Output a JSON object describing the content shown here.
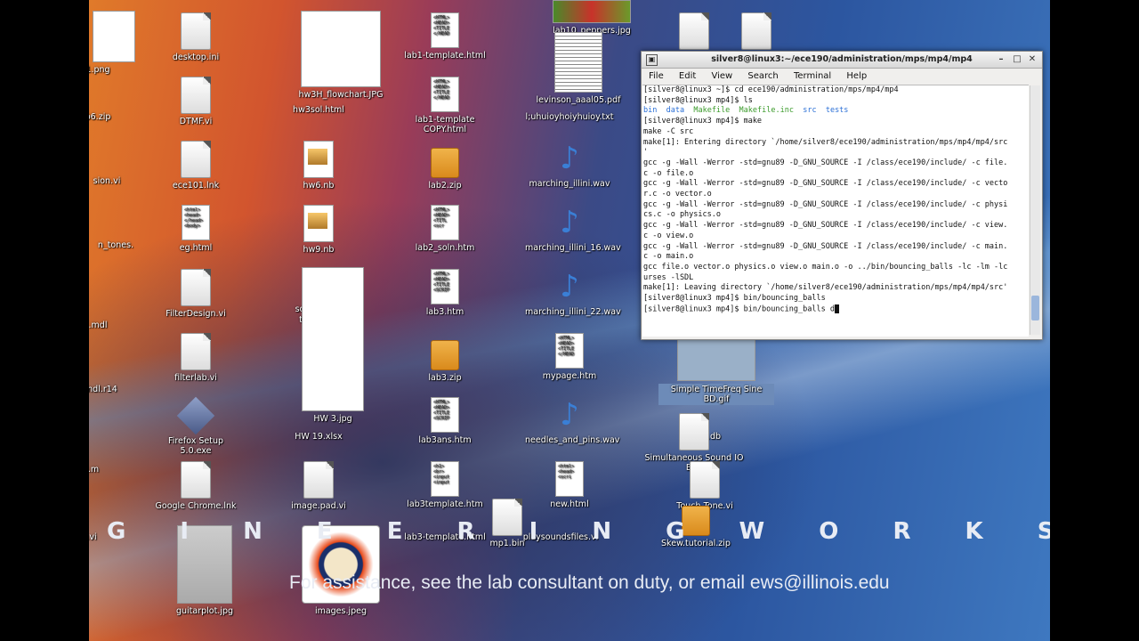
{
  "desktop": {
    "icons": [
      {
        "label": "1.png"
      },
      {
        "label": "desktop.ini"
      },
      {
        "label": "hw3H_flowchart.JPG"
      },
      {
        "label": "lab1-template.html"
      },
      {
        "label": "lab10_peppers.jpg"
      },
      {
        "label": "b6.zip"
      },
      {
        "label": "DTMF.vi"
      },
      {
        "label": "hw3sol.html"
      },
      {
        "label": "lab1-template COPY.html"
      },
      {
        "label": "levinson_aaal05.pdf"
      },
      {
        "label": "l;uhuioyhoiyhuioy.txt"
      },
      {
        "label": "sion.vi"
      },
      {
        "label": "ece101.lnk"
      },
      {
        "label": "hw6.nb"
      },
      {
        "label": "lab2.zip"
      },
      {
        "label": "marching_illini.wav"
      },
      {
        "label": "n_tones."
      },
      {
        "label": "eg.html"
      },
      {
        "label": "hw9.nb"
      },
      {
        "label": "lab2_soln.htm"
      },
      {
        "label": "marching_illini_16.wav"
      },
      {
        "label": ".mdl"
      },
      {
        "label": "FilterDesign.vi"
      },
      {
        "label": "sou"
      },
      {
        "label": "lab3.htm"
      },
      {
        "label": "marching_illini_22.wav"
      },
      {
        "label": "tr"
      },
      {
        "label": "ndl.r14"
      },
      {
        "label": "filterlab.vi"
      },
      {
        "label": "lab3.zip"
      },
      {
        "label": "mypage.htm"
      },
      {
        "label": "Simple TimeFreq Sine BD.gif"
      },
      {
        "label": "Firefox Setup 5.0.exe"
      },
      {
        "label": "HW 3.jpg"
      },
      {
        "label": "HW 19.xlsx"
      },
      {
        "label": "lab3ans.htm"
      },
      {
        "label": "needles_and_pins.wav"
      },
      {
        "label": "s.db"
      },
      {
        "label": "Simultaneous Sound IO Bea"
      },
      {
        "label": ".m"
      },
      {
        "label": "Google Chrome.lnk"
      },
      {
        "label": "image.pad.vi"
      },
      {
        "label": "lab3template.htm"
      },
      {
        "label": "new.html"
      },
      {
        "label": "Touch Tone.vi"
      },
      {
        "label": "d.vi"
      },
      {
        "label": "lab3-template.html"
      },
      {
        "label": "mp1.bin"
      },
      {
        "label": "playsoundsfiles.vi"
      },
      {
        "label": "Skew.tutorial.zip"
      },
      {
        "label": "guitarplot.jpg"
      },
      {
        "label": "images.jpeg"
      }
    ],
    "banner": "G I N E E R I N G   W O R K S T A T I O N S   L A B O R",
    "footer": "For assistance, see the lab consultant on duty, or email ews@illinois.edu"
  },
  "terminal": {
    "title": "silver8@linux3:~/ece190/administration/mps/mp4/mp4",
    "menu": [
      "File",
      "Edit",
      "View",
      "Search",
      "Terminal",
      "Help"
    ],
    "lines": [
      "[silver8@linux3 ~]$ cd ece190/administration/mps/mp4/mp4",
      "[silver8@linux3 mp4]$ ls",
      "LS_LINE",
      "[silver8@linux3 mp4]$ make",
      "make -C src",
      "make[1]: Entering directory `/home/silver8/ece190/administration/mps/mp4/mp4/src",
      "'",
      "gcc -g -Wall -Werror -std=gnu89 -D_GNU_SOURCE -I /class/ece190/include/ -c file.",
      "c -o file.o",
      "gcc -g -Wall -Werror -std=gnu89 -D_GNU_SOURCE -I /class/ece190/include/ -c vecto",
      "r.c -o vector.o",
      "gcc -g -Wall -Werror -std=gnu89 -D_GNU_SOURCE -I /class/ece190/include/ -c physi",
      "cs.c -o physics.o",
      "gcc -g -Wall -Werror -std=gnu89 -D_GNU_SOURCE -I /class/ece190/include/ -c view.",
      "c -o view.o",
      "gcc -g -Wall -Werror -std=gnu89 -D_GNU_SOURCE -I /class/ece190/include/ -c main.",
      "c -o main.o",
      "gcc file.o vector.o physics.o view.o main.o -o ../bin/bouncing_balls -lc -lm -lc",
      "urses -lSDL",
      "make[1]: Leaving directory `/home/silver8/ece190/administration/mps/mp4/mp4/src'",
      "[silver8@linux3 mp4]$ bin/bouncing_balls",
      "[silver8@linux3 mp4]$ bin/bouncing_balls d"
    ],
    "ls_output": [
      "bin",
      "data",
      "Makefile",
      "Makefile.inc",
      "src",
      "tests"
    ]
  }
}
